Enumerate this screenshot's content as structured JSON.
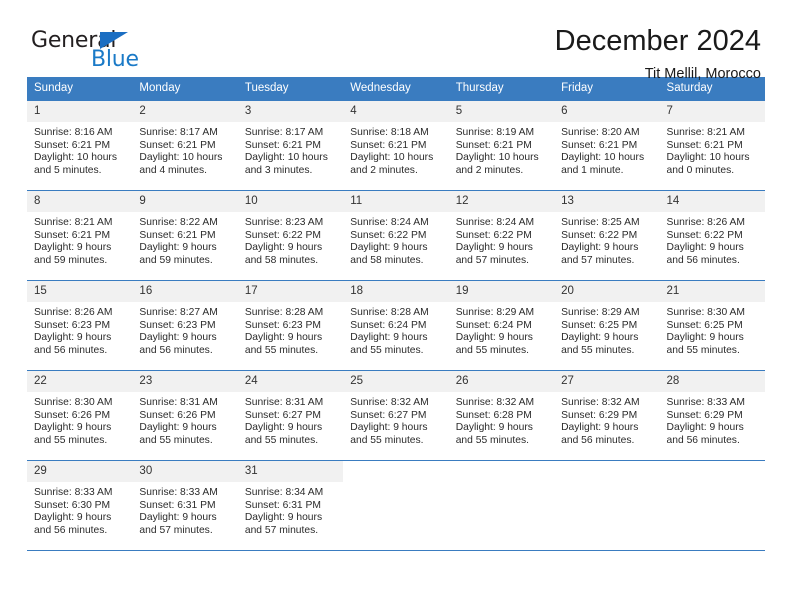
{
  "brand": {
    "name_part1": "General",
    "name_part2": "Blue",
    "triangle_color": "#1b6ec2",
    "blue_color": "#1b7ac7"
  },
  "header": {
    "title": "December 2024",
    "location": "Tit Mellil, Morocco"
  },
  "theme": {
    "header_bg": "#3a7cc0",
    "header_text": "#ffffff",
    "daynum_bg": "#f1f1f1",
    "row_border": "#3a7cc0"
  },
  "labels": {
    "sunrise_prefix": "Sunrise:",
    "sunset_prefix": "Sunset:",
    "daylight_prefix": "Daylight:"
  },
  "weekdays": [
    "Sunday",
    "Monday",
    "Tuesday",
    "Wednesday",
    "Thursday",
    "Friday",
    "Saturday"
  ],
  "weeks": [
    [
      {
        "day": "1",
        "sunrise": "Sunrise: 8:16 AM",
        "sunset": "Sunset: 6:21 PM",
        "daylight": "Daylight: 10 hours and 5 minutes."
      },
      {
        "day": "2",
        "sunrise": "Sunrise: 8:17 AM",
        "sunset": "Sunset: 6:21 PM",
        "daylight": "Daylight: 10 hours and 4 minutes."
      },
      {
        "day": "3",
        "sunrise": "Sunrise: 8:17 AM",
        "sunset": "Sunset: 6:21 PM",
        "daylight": "Daylight: 10 hours and 3 minutes."
      },
      {
        "day": "4",
        "sunrise": "Sunrise: 8:18 AM",
        "sunset": "Sunset: 6:21 PM",
        "daylight": "Daylight: 10 hours and 2 minutes."
      },
      {
        "day": "5",
        "sunrise": "Sunrise: 8:19 AM",
        "sunset": "Sunset: 6:21 PM",
        "daylight": "Daylight: 10 hours and 2 minutes."
      },
      {
        "day": "6",
        "sunrise": "Sunrise: 8:20 AM",
        "sunset": "Sunset: 6:21 PM",
        "daylight": "Daylight: 10 hours and 1 minute."
      },
      {
        "day": "7",
        "sunrise": "Sunrise: 8:21 AM",
        "sunset": "Sunset: 6:21 PM",
        "daylight": "Daylight: 10 hours and 0 minutes."
      }
    ],
    [
      {
        "day": "8",
        "sunrise": "Sunrise: 8:21 AM",
        "sunset": "Sunset: 6:21 PM",
        "daylight": "Daylight: 9 hours and 59 minutes."
      },
      {
        "day": "9",
        "sunrise": "Sunrise: 8:22 AM",
        "sunset": "Sunset: 6:21 PM",
        "daylight": "Daylight: 9 hours and 59 minutes."
      },
      {
        "day": "10",
        "sunrise": "Sunrise: 8:23 AM",
        "sunset": "Sunset: 6:22 PM",
        "daylight": "Daylight: 9 hours and 58 minutes."
      },
      {
        "day": "11",
        "sunrise": "Sunrise: 8:24 AM",
        "sunset": "Sunset: 6:22 PM",
        "daylight": "Daylight: 9 hours and 58 minutes."
      },
      {
        "day": "12",
        "sunrise": "Sunrise: 8:24 AM",
        "sunset": "Sunset: 6:22 PM",
        "daylight": "Daylight: 9 hours and 57 minutes."
      },
      {
        "day": "13",
        "sunrise": "Sunrise: 8:25 AM",
        "sunset": "Sunset: 6:22 PM",
        "daylight": "Daylight: 9 hours and 57 minutes."
      },
      {
        "day": "14",
        "sunrise": "Sunrise: 8:26 AM",
        "sunset": "Sunset: 6:22 PM",
        "daylight": "Daylight: 9 hours and 56 minutes."
      }
    ],
    [
      {
        "day": "15",
        "sunrise": "Sunrise: 8:26 AM",
        "sunset": "Sunset: 6:23 PM",
        "daylight": "Daylight: 9 hours and 56 minutes."
      },
      {
        "day": "16",
        "sunrise": "Sunrise: 8:27 AM",
        "sunset": "Sunset: 6:23 PM",
        "daylight": "Daylight: 9 hours and 56 minutes."
      },
      {
        "day": "17",
        "sunrise": "Sunrise: 8:28 AM",
        "sunset": "Sunset: 6:23 PM",
        "daylight": "Daylight: 9 hours and 55 minutes."
      },
      {
        "day": "18",
        "sunrise": "Sunrise: 8:28 AM",
        "sunset": "Sunset: 6:24 PM",
        "daylight": "Daylight: 9 hours and 55 minutes."
      },
      {
        "day": "19",
        "sunrise": "Sunrise: 8:29 AM",
        "sunset": "Sunset: 6:24 PM",
        "daylight": "Daylight: 9 hours and 55 minutes."
      },
      {
        "day": "20",
        "sunrise": "Sunrise: 8:29 AM",
        "sunset": "Sunset: 6:25 PM",
        "daylight": "Daylight: 9 hours and 55 minutes."
      },
      {
        "day": "21",
        "sunrise": "Sunrise: 8:30 AM",
        "sunset": "Sunset: 6:25 PM",
        "daylight": "Daylight: 9 hours and 55 minutes."
      }
    ],
    [
      {
        "day": "22",
        "sunrise": "Sunrise: 8:30 AM",
        "sunset": "Sunset: 6:26 PM",
        "daylight": "Daylight: 9 hours and 55 minutes."
      },
      {
        "day": "23",
        "sunrise": "Sunrise: 8:31 AM",
        "sunset": "Sunset: 6:26 PM",
        "daylight": "Daylight: 9 hours and 55 minutes."
      },
      {
        "day": "24",
        "sunrise": "Sunrise: 8:31 AM",
        "sunset": "Sunset: 6:27 PM",
        "daylight": "Daylight: 9 hours and 55 minutes."
      },
      {
        "day": "25",
        "sunrise": "Sunrise: 8:32 AM",
        "sunset": "Sunset: 6:27 PM",
        "daylight": "Daylight: 9 hours and 55 minutes."
      },
      {
        "day": "26",
        "sunrise": "Sunrise: 8:32 AM",
        "sunset": "Sunset: 6:28 PM",
        "daylight": "Daylight: 9 hours and 55 minutes."
      },
      {
        "day": "27",
        "sunrise": "Sunrise: 8:32 AM",
        "sunset": "Sunset: 6:29 PM",
        "daylight": "Daylight: 9 hours and 56 minutes."
      },
      {
        "day": "28",
        "sunrise": "Sunrise: 8:33 AM",
        "sunset": "Sunset: 6:29 PM",
        "daylight": "Daylight: 9 hours and 56 minutes."
      }
    ],
    [
      {
        "day": "29",
        "sunrise": "Sunrise: 8:33 AM",
        "sunset": "Sunset: 6:30 PM",
        "daylight": "Daylight: 9 hours and 56 minutes."
      },
      {
        "day": "30",
        "sunrise": "Sunrise: 8:33 AM",
        "sunset": "Sunset: 6:31 PM",
        "daylight": "Daylight: 9 hours and 57 minutes."
      },
      {
        "day": "31",
        "sunrise": "Sunrise: 8:34 AM",
        "sunset": "Sunset: 6:31 PM",
        "daylight": "Daylight: 9 hours and 57 minutes."
      },
      {
        "day": "",
        "sunrise": "",
        "sunset": "",
        "daylight": ""
      },
      {
        "day": "",
        "sunrise": "",
        "sunset": "",
        "daylight": ""
      },
      {
        "day": "",
        "sunrise": "",
        "sunset": "",
        "daylight": ""
      },
      {
        "day": "",
        "sunrise": "",
        "sunset": "",
        "daylight": ""
      }
    ]
  ]
}
